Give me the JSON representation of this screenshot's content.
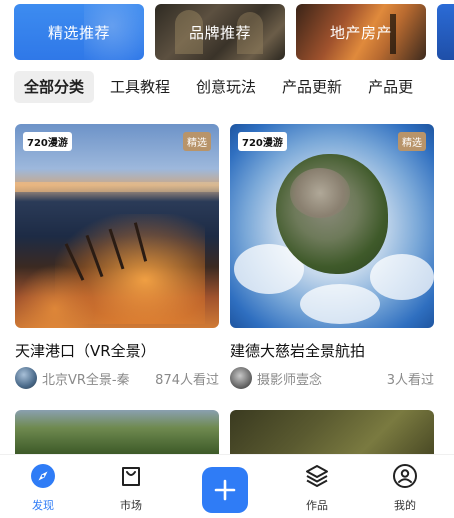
{
  "banners": [
    {
      "label": "精选推荐"
    },
    {
      "label": "品牌推荐"
    },
    {
      "label": "地产房产"
    }
  ],
  "tabs": [
    {
      "label": "全部分类",
      "active": true
    },
    {
      "label": "工具教程"
    },
    {
      "label": "创意玩法"
    },
    {
      "label": "产品更新"
    },
    {
      "label": "产品更"
    }
  ],
  "cards": [
    {
      "badge": "720漫游",
      "tag": "精选",
      "title": "天津港口（VR全景）",
      "author": "北京VR全景-秦",
      "views": "874人看过"
    },
    {
      "badge": "720漫游",
      "tag": "精选",
      "title": "建德大慈岩全景航拍",
      "author": "摄影师壹念",
      "views": "3人看过"
    }
  ],
  "bottom_nav": {
    "discover": "发现",
    "market": "市场",
    "works": "作品",
    "mine": "我的"
  },
  "colors": {
    "accent": "#2f7cf6",
    "featured_tag": "#b8946a"
  }
}
